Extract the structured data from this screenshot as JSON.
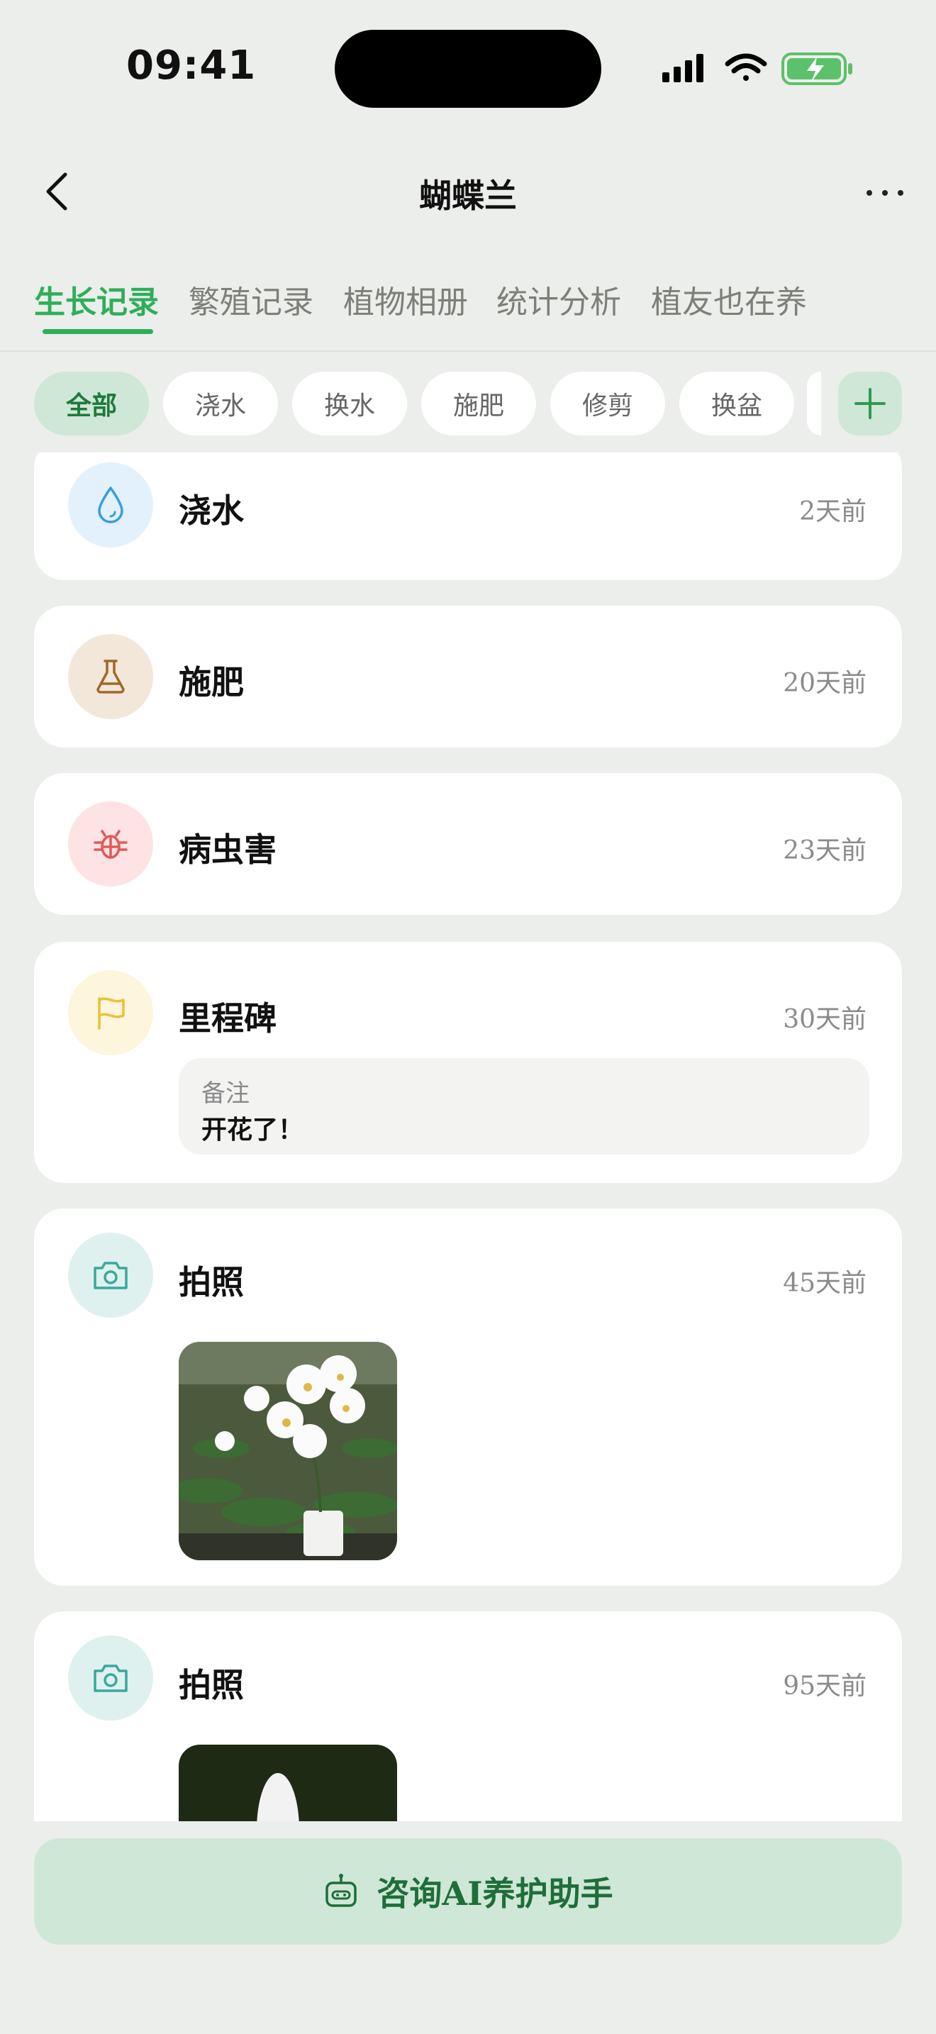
{
  "status_bar": {
    "time": "09:41"
  },
  "nav": {
    "title": "蝴蝶兰"
  },
  "tabs": [
    {
      "label": "生长记录",
      "active": true
    },
    {
      "label": "繁殖记录"
    },
    {
      "label": "植物相册"
    },
    {
      "label": "统计分析"
    },
    {
      "label": "植友也在养"
    }
  ],
  "filters": [
    {
      "label": "全部",
      "active": true
    },
    {
      "label": "浇水"
    },
    {
      "label": "换水"
    },
    {
      "label": "施肥"
    },
    {
      "label": "修剪"
    },
    {
      "label": "换盆"
    }
  ],
  "records": [
    {
      "type": "浇水",
      "time": "2天前",
      "icon": "water-drop-icon",
      "color": "#3b9be0",
      "bg": "#e3f1fc"
    },
    {
      "type": "施肥",
      "time": "20天前",
      "icon": "flask-icon",
      "color": "#a0682a",
      "bg": "#f3e7da"
    },
    {
      "type": "病虫害",
      "time": "23天前",
      "icon": "bug-icon",
      "color": "#e05a5a",
      "bg": "#fde3e3"
    },
    {
      "type": "里程碑",
      "time": "30天前",
      "icon": "flag-icon",
      "color": "#e8c23a",
      "bg": "#fdf5dc",
      "note_label": "备注",
      "note_text": "开花了！"
    },
    {
      "type": "拍照",
      "time": "45天前",
      "icon": "camera-icon",
      "color": "#3aa89c",
      "bg": "#dff1ee"
    },
    {
      "type": "拍照",
      "time": "95天前",
      "icon": "camera-icon",
      "color": "#3aa89c",
      "bg": "#dff1ee"
    }
  ],
  "ai_button": {
    "label": "咨询AI养护助手"
  },
  "colors": {
    "accent": "#2eae5a",
    "background": "#eceeeb",
    "chip_active_bg": "#cfe7d6"
  }
}
